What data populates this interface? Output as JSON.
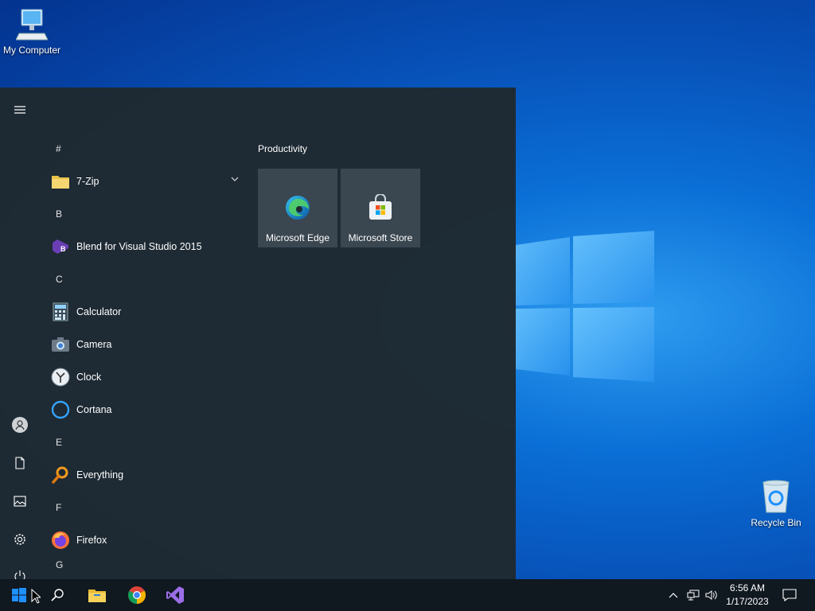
{
  "desktop": {
    "icons": [
      {
        "label": "My Computer"
      },
      {
        "label": "Recycle Bin"
      }
    ]
  },
  "start_menu": {
    "app_list": {
      "items": [
        {
          "kind": "letter",
          "label": "#"
        },
        {
          "kind": "app",
          "label": "7-Zip",
          "icon": "folder-icon",
          "expandable": true
        },
        {
          "kind": "letter",
          "label": "B"
        },
        {
          "kind": "app",
          "label": "Blend for Visual Studio 2015",
          "icon": "blend-icon"
        },
        {
          "kind": "letter",
          "label": "C"
        },
        {
          "kind": "app",
          "label": "Calculator",
          "icon": "calculator-icon"
        },
        {
          "kind": "app",
          "label": "Camera",
          "icon": "camera-icon"
        },
        {
          "kind": "app",
          "label": "Clock",
          "icon": "clock-icon"
        },
        {
          "kind": "app",
          "label": "Cortana",
          "icon": "cortana-icon"
        },
        {
          "kind": "letter",
          "label": "E"
        },
        {
          "kind": "app",
          "label": "Everything",
          "icon": "everything-icon"
        },
        {
          "kind": "letter",
          "label": "F"
        },
        {
          "kind": "app",
          "label": "Firefox",
          "icon": "firefox-icon"
        },
        {
          "kind": "letter",
          "label": "G"
        }
      ]
    },
    "tiles": {
      "group_title": "Productivity",
      "items": [
        {
          "label": "Microsoft Edge",
          "icon": "edge-icon"
        },
        {
          "label": "Microsoft Store",
          "icon": "store-icon"
        }
      ]
    },
    "rail": [
      "hamburger-menu-icon",
      "user-icon",
      "documents-icon",
      "pictures-icon",
      "settings-icon",
      "power-icon"
    ]
  },
  "taskbar": {
    "pinned": [
      "start-icon",
      "search-icon",
      "file-explorer-icon",
      "chrome-icon",
      "visual-studio-icon"
    ],
    "tray": [
      "show-hidden-icons-icon",
      "network-icon",
      "volume-icon"
    ],
    "clock": {
      "time": "6:56 AM",
      "date": "1/17/2023"
    }
  },
  "colors": {
    "start_bg": "#1f2930",
    "taskbar_bg": "#101820",
    "accent": "#0078d7"
  }
}
